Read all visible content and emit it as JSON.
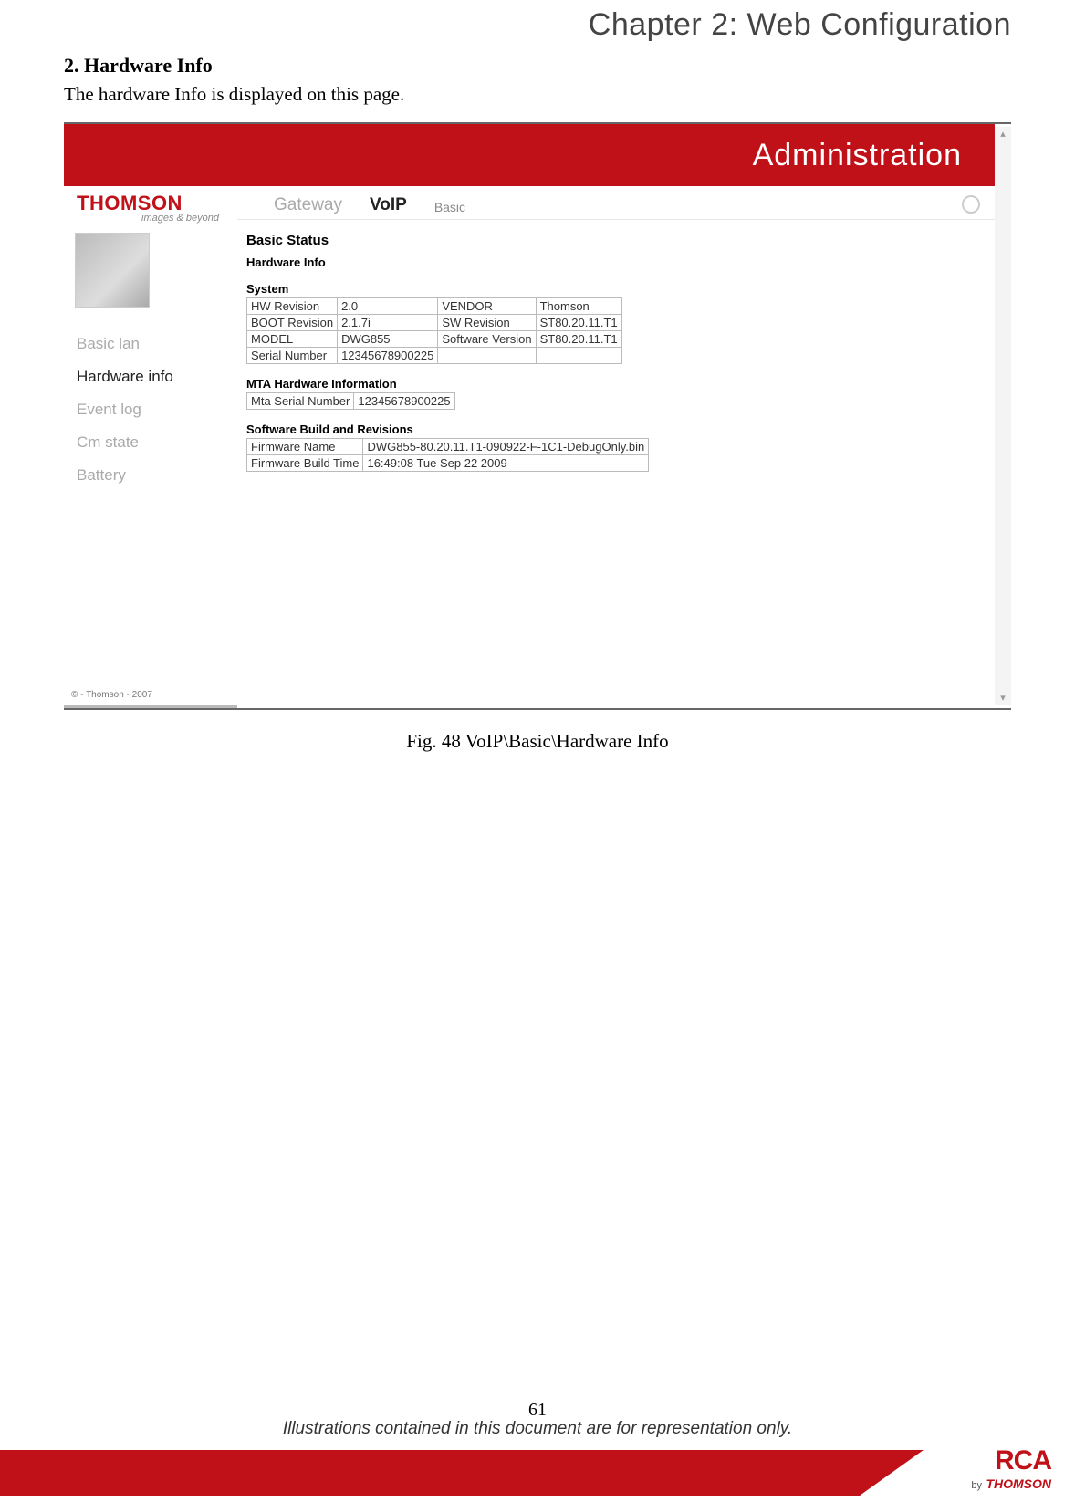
{
  "chapter": "Chapter 2: Web Configuration",
  "section_heading": "2. Hardware Info",
  "body_text": "The hardware Info is displayed on this page.",
  "figure_caption": "Fig. 48 VoIP\\Basic\\Hardware Info",
  "page_number": "61",
  "disclaimer": "Illustrations contained in this document are for representation only.",
  "footer_logo": {
    "brand": "RCA",
    "by": "by",
    "maker": "THOMSON"
  },
  "ui": {
    "banner_title": "Administration",
    "logo_main": "THOMSON",
    "logo_sub": "images & beyond",
    "copyright": "© - Thomson - 2007",
    "tabs": {
      "items": [
        {
          "label": "Gateway",
          "active": false
        },
        {
          "label": "VoIP",
          "active": true
        }
      ],
      "subtab": "Basic"
    },
    "sidenav": [
      {
        "label": "Basic lan",
        "active": false
      },
      {
        "label": "Hardware info",
        "active": true
      },
      {
        "label": "Event log",
        "active": false
      },
      {
        "label": "Cm state",
        "active": false
      },
      {
        "label": "Battery",
        "active": false
      }
    ],
    "content_title": "Basic Status",
    "content_subtitle": "Hardware Info",
    "system_table": {
      "header": "System",
      "rows": [
        [
          "HW Revision",
          "2.0",
          "VENDOR",
          "Thomson"
        ],
        [
          "BOOT Revision",
          "2.1.7i",
          "SW Revision",
          "ST80.20.11.T1"
        ],
        [
          "MODEL",
          "DWG855",
          "Software Version",
          "ST80.20.11.T1"
        ],
        [
          "Serial Number",
          "12345678900225",
          "",
          ""
        ]
      ]
    },
    "mta_table": {
      "header": "MTA Hardware Information",
      "rows": [
        [
          "Mta Serial Number",
          "12345678900225"
        ]
      ]
    },
    "build_table": {
      "header": "Software Build and Revisions",
      "rows": [
        [
          "Firmware Name",
          "DWG855-80.20.11.T1-090922-F-1C1-DebugOnly.bin"
        ],
        [
          "Firmware Build Time",
          "16:49:08 Tue Sep 22 2009"
        ]
      ]
    }
  }
}
